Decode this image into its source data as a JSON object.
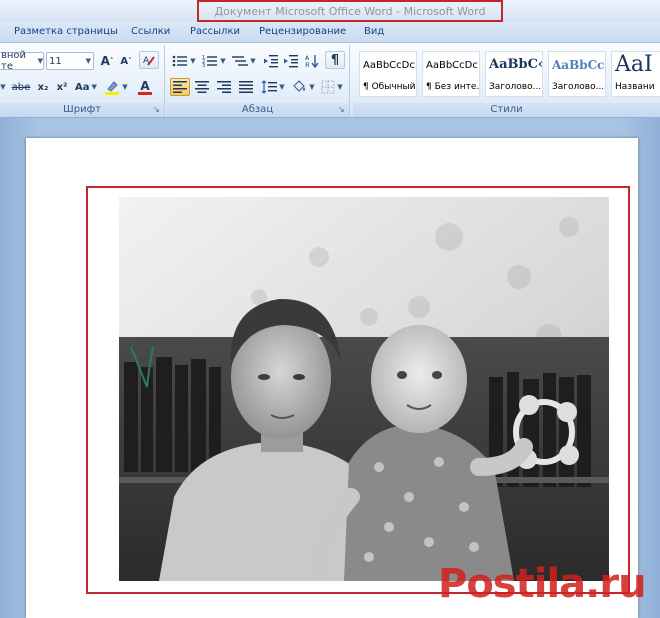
{
  "window": {
    "title": "Документ Microsoft Office Word - Microsoft Word"
  },
  "ribbon_tabs": [
    {
      "label": "Разметка страницы"
    },
    {
      "label": "Ссылки"
    },
    {
      "label": "Рассылки"
    },
    {
      "label": "Рецензирование"
    },
    {
      "label": "Вид"
    }
  ],
  "font_group": {
    "font_name": "вной те",
    "font_size": "11",
    "label": "Шрифт",
    "grow_label": "A",
    "shrink_label": "A",
    "strike_label": "abe",
    "sub_label": "x₂",
    "sup_label": "x²",
    "case_label": "Aa",
    "font_color_label": "A"
  },
  "paragraph_group": {
    "label": "Абзац"
  },
  "styles_group": {
    "label": "Стили",
    "items": [
      {
        "sample": "AaBbCcDc",
        "name": "¶ Обычный"
      },
      {
        "sample": "AaBbCcDc",
        "name": "¶ Без инте..."
      },
      {
        "sample": "AaBbC‹",
        "name": "Заголово..."
      },
      {
        "sample": "AaBbCc",
        "name": "Заголово..."
      },
      {
        "sample": "AaI",
        "name": "Названи"
      }
    ]
  },
  "watermark": {
    "text": "Postila.ru"
  },
  "colors": {
    "accent_red": "#c0282d",
    "ribbon_text": "#15428b"
  }
}
